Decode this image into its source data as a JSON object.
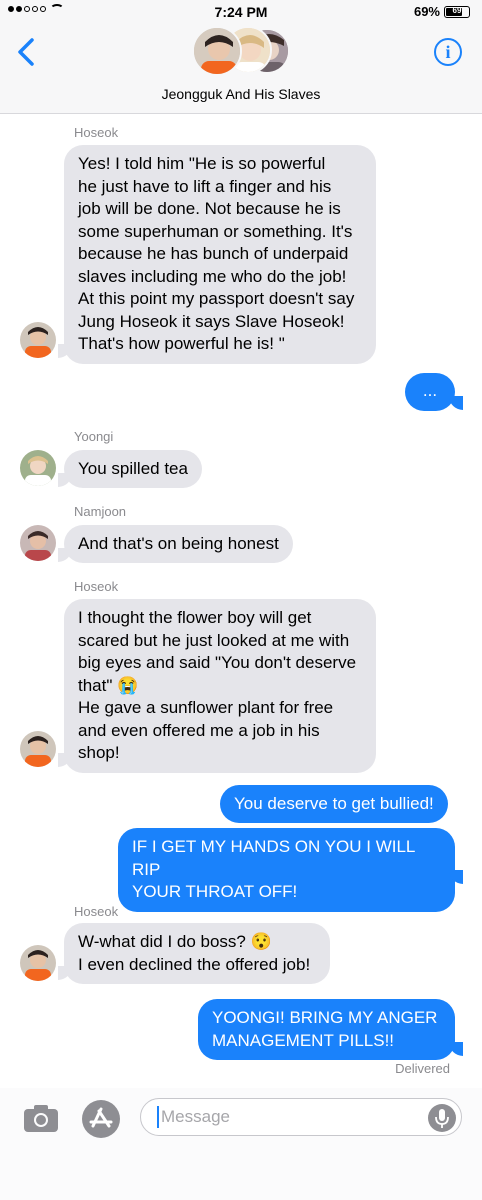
{
  "status_bar": {
    "time": "7:24 PM",
    "battery": "69%",
    "battery_level": "69"
  },
  "header": {
    "back_icon": "chevron-left-icon",
    "info_icon": "info-icon",
    "info_label": "i",
    "group_name": "Jeongguk And His Slaves"
  },
  "messages": [
    {
      "sender": "Hoseok",
      "direction": "incoming",
      "lines": [
        "Yes! I told him \"He is so powerful",
        "he just have to lift a finger and his",
        "job will be done. Not because he is",
        "some superhuman or something. It's",
        "because he has bunch of underpaid",
        "slaves including me who do the job!",
        "At this point my passport doesn't say",
        "Jung Hoseok it says Slave Hoseok!",
        "That's how powerful he is! \""
      ]
    },
    {
      "direction": "outgoing",
      "lines": [
        "..."
      ]
    },
    {
      "sender": "Yoongi",
      "direction": "incoming",
      "lines": [
        "You spilled tea"
      ]
    },
    {
      "sender": "Namjoon",
      "direction": "incoming",
      "lines": [
        "And that's on being honest"
      ]
    },
    {
      "sender": "Hoseok",
      "direction": "incoming",
      "lines": [
        "I thought the flower boy will get",
        "scared but he just looked at me with",
        "big eyes and said \"You don't deserve",
        "that\" 😭",
        "He gave a sunflower plant for free",
        "and even offered me a job in his",
        "shop!"
      ]
    },
    {
      "direction": "outgoing",
      "lines": [
        "You deserve to get bullied!"
      ]
    },
    {
      "direction": "outgoing",
      "lines": [
        "IF I GET MY HANDS ON YOU I WILL RIP",
        "YOUR THROAT OFF!"
      ]
    },
    {
      "sender": "Hoseok",
      "direction": "incoming",
      "lines": [
        "W-what did I do boss? 😯",
        "I even declined the offered job!"
      ]
    },
    {
      "direction": "outgoing",
      "lines": [
        "YOONGI! BRING MY ANGER",
        "MANAGEMENT PILLS!!"
      ]
    }
  ],
  "delivered_label": "Delivered",
  "input_bar": {
    "placeholder": "Message",
    "camera_icon": "camera-icon",
    "appstore_icon": "app-store-icon",
    "mic_icon": "microphone-icon"
  },
  "colors": {
    "accent": "#1a82fb",
    "incoming_bubble": "#e5e5ea",
    "outgoing_text": "#ffffff",
    "sender_label": "#8a8a8e"
  }
}
